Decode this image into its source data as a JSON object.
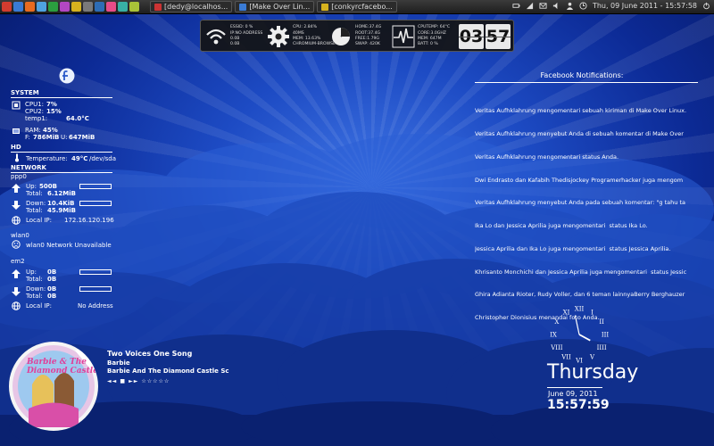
{
  "panel": {
    "tasks": [
      {
        "label": "[dedy@localhos..."
      },
      {
        "label": "[Make Over Lin..."
      },
      {
        "label": "[conkyrcfacebo..."
      }
    ],
    "clock": "Thu, 09 June 2011 - 15:57:58",
    "colors": [
      "#d13c2f",
      "#3a7bd5",
      "#e86b1f",
      "#4fa3e0",
      "#2b9e3f",
      "#b347c2",
      "#d6b21e",
      "#7a7a7a",
      "#2e6db5",
      "#e84c88",
      "#38b0a5",
      "#a9c238"
    ]
  },
  "topbar": {
    "block1": [
      "ESSID: 0 %",
      "IP:NO ADDRESS",
      "0.0B",
      "0.0B"
    ],
    "block2": [
      "CPU: 2.84%",
      "40MS",
      "MEM: 13.63%",
      "CHROMIUM-BROWSE"
    ],
    "block3": [
      "HOME:37.4G",
      "ROOT:37.4G",
      "FREE:1.79G",
      "SWAP: 420K"
    ],
    "block4": [
      "CPUTEMP: 64°C",
      "CORE:3.0GHZ",
      "MEM: 647M",
      "BATT: 0 %"
    ],
    "hour": "03",
    "minute": "57"
  },
  "sidebar": {
    "system_header": "SYSTEM",
    "cpu1_label": "CPU1:",
    "cpu1": "7%",
    "cpu2_label": "CPU2:",
    "cpu2": "15%",
    "temp1_label": "temp1:",
    "temp1": "64.0°C",
    "ram_label": "RAM:",
    "ram": "45%",
    "f_label": "F:",
    "f": "786MiB",
    "u_label": "U:",
    "u": "647MiB",
    "hd_header": "HD",
    "temperature_label": "Temperature:",
    "temperature": "49°C",
    "device": "/dev/sda",
    "network_header": "NETWORK",
    "ppp0": "ppp0",
    "up_label": "Up:",
    "ppp0_up": "500B",
    "total_label": "Total:",
    "ppp0_up_total": "6.12MiB",
    "down_label": "Down:",
    "ppp0_down": "10.4KiB",
    "ppp0_down_total": "45.9MiB",
    "local_ip_label": "Local IP:",
    "ppp0_ip": "172.16.120.196",
    "wlan0": "wlan0",
    "wlan0_status": "wlan0 Network Unavailable",
    "em2": "em2",
    "em2_up": "0B",
    "em2_up_total": "0B",
    "em2_down": "0B",
    "em2_down_total": "0B",
    "em2_ip": "No Address"
  },
  "facebook": {
    "title": "Facebook Notifications:",
    "lines": [
      "Veritas Aufhklahrung mengomentari sebuah kiriman di Make Over Linux.",
      "Veritas Aufhklahrung menyebut Anda di sebuah komentar di Make Over",
      "Veritas Aufhklahrung mengomentari status Anda.",
      "Dwi Endrasto dan Kafabih Thedisjockey Programerhacker juga mengom",
      "Veritas Aufhklahrung menyebut Anda pada sebuah komentar: \"g tahu ta",
      "Ika Lo dan Jessica Aprilia juga mengomentari  status Ika Lo.",
      "Jessica Aprilia dan Ika Lo juga mengomentari  status Jessica Aprilia.",
      "Khrisanto Monchichi dan Jessica Aprilia juga mengomentari  status Jessic",
      "Ghira Adianta Rioter, Rudy Voller, dan 6 teman lainnyaBerry Berghauzer",
      "Christopher Dionisius menandai foto Anda."
    ]
  },
  "clock": {
    "day": "Thursday",
    "date": "June 09, 2011",
    "time": "15:57:59"
  },
  "music": {
    "title": "Two Voices One Song",
    "artist": "Barbie",
    "album": "Barbie And The Diamond Castle Sc",
    "controls": "◄◄ ■ ►► ☆☆☆☆☆",
    "cover_text": "Barbie & The Diamond Castle"
  }
}
